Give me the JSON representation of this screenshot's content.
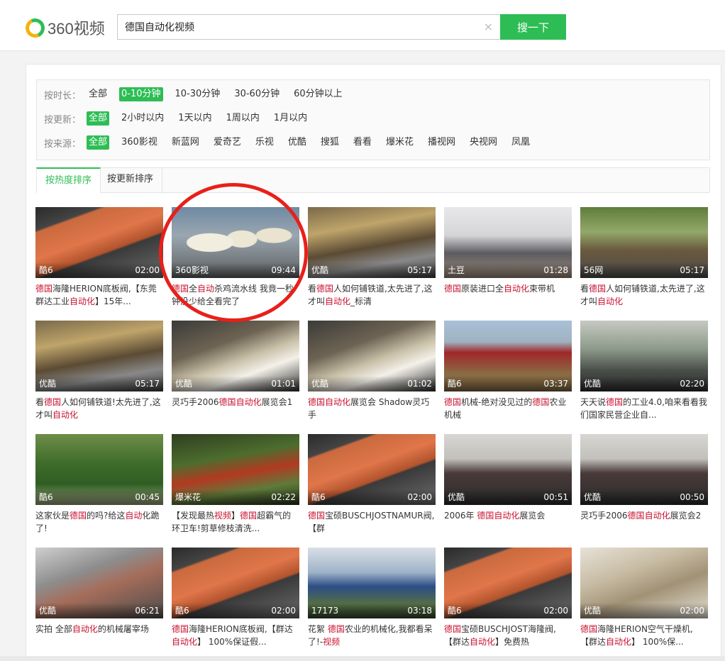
{
  "header": {
    "logo_text": "360视频",
    "search_value": "德国自动化视频",
    "clear_icon": "×",
    "search_button": "搜一下"
  },
  "filters": {
    "time": {
      "label": "按时长：",
      "options": [
        "全部",
        "0-10分钟",
        "10-30分钟",
        "30-60分钟",
        "60分钟以上"
      ],
      "active": 1
    },
    "update": {
      "label": "按更新：",
      "options": [
        "全部",
        "2小时以内",
        "1天以内",
        "1周以内",
        "1月以内"
      ],
      "active": 0
    },
    "source": {
      "label": "按来源：",
      "options": [
        "全部",
        "360影视",
        "新蓝网",
        "爱奇艺",
        "乐视",
        "优酷",
        "搜狐",
        "看看",
        "爆米花",
        "播视网",
        "央视网",
        "凤凰"
      ],
      "active": 0
    }
  },
  "tabs": [
    "按热度排序",
    "按更新排序"
  ],
  "videos": [
    {
      "source": "酷6",
      "duration": "02:00",
      "title": [
        [
          "德国",
          true
        ],
        [
          "海隆HERION底板阀,【东莞群达工业",
          false
        ],
        [
          "自动化",
          true
        ],
        [
          "】15年...",
          false
        ]
      ],
      "thumb": "t-orange"
    },
    {
      "source": "360影视",
      "duration": "09:44",
      "title": [
        [
          "德国",
          true
        ],
        [
          "全",
          false
        ],
        [
          "自动",
          true
        ],
        [
          "杀鸡流水线 我竟一秒钟没少给全看完了",
          false
        ]
      ],
      "thumb": "t-chicken"
    },
    {
      "source": "优酷",
      "duration": "05:17",
      "title": [
        [
          "看",
          false
        ],
        [
          "德国",
          true
        ],
        [
          "人如何铺铁道,太先进了,这才叫",
          false
        ],
        [
          "自动化",
          true
        ],
        [
          "_标清",
          false
        ]
      ],
      "thumb": "t-rail"
    },
    {
      "source": "土豆",
      "duration": "01:28",
      "title": [
        [
          "德国",
          true
        ],
        [
          "原装进口全",
          false
        ],
        [
          "自动化",
          true
        ],
        [
          "束带机",
          false
        ]
      ],
      "thumb": "t-machine"
    },
    {
      "source": "56网",
      "duration": "05:17",
      "title": [
        [
          "看",
          false
        ],
        [
          "德国",
          true
        ],
        [
          "人如何铺铁道,太先进了,这才叫",
          false
        ],
        [
          "自动化",
          true
        ]
      ],
      "thumb": "t-field"
    },
    {
      "source": "优酷",
      "duration": "05:17",
      "title": [
        [
          "看",
          false
        ],
        [
          "德国",
          true
        ],
        [
          "人如何铺铁道!太先进了,这才叫",
          false
        ],
        [
          "自动化",
          true
        ]
      ],
      "thumb": "t-rail"
    },
    {
      "source": "优酷",
      "duration": "01:01",
      "title": [
        [
          "灵巧手2006",
          false
        ],
        [
          "德国",
          true
        ],
        [
          "自动化",
          true
        ],
        [
          "展览会1",
          false
        ]
      ],
      "thumb": "t-robot"
    },
    {
      "source": "优酷",
      "duration": "01:02",
      "title": [
        [
          "德国",
          true
        ],
        [
          "自动化",
          true
        ],
        [
          "展览会 Shadow灵巧手",
          false
        ]
      ],
      "thumb": "t-robot"
    },
    {
      "source": "酷6",
      "duration": "03:37",
      "title": [
        [
          "德国",
          true
        ],
        [
          "机械-绝对没见过的",
          false
        ],
        [
          "德国",
          true
        ],
        [
          "农业机械",
          false
        ]
      ],
      "thumb": "t-tractor"
    },
    {
      "source": "优酷",
      "duration": "02:20",
      "title": [
        [
          "天天说",
          false
        ],
        [
          "德国",
          true
        ],
        [
          "的工业4.0,咱来看看我们国家民营企业自...",
          false
        ]
      ],
      "thumb": "t-factory"
    },
    {
      "source": "酷6",
      "duration": "00:45",
      "title": [
        [
          "这家伙是",
          false
        ],
        [
          "德国",
          true
        ],
        [
          "的吗?给这",
          false
        ],
        [
          "自动",
          true
        ],
        [
          "化",
          false
        ],
        [
          "跪了!",
          false
        ]
      ],
      "thumb": "t-hedge"
    },
    {
      "source": "爆米花",
      "duration": "02:22",
      "title": [
        [
          "【发现最热",
          false
        ],
        [
          "视频",
          true
        ],
        [
          "】",
          false
        ],
        [
          "德国",
          true
        ],
        [
          "超霸气的环卫车!剪草修枝清洗...",
          false
        ]
      ],
      "thumb": "t-garden"
    },
    {
      "source": "酷6",
      "duration": "02:00",
      "title": [
        [
          "德国",
          true
        ],
        [
          "宝硕BUSCHJOSTNAMUR阀,【群",
          false
        ]
      ],
      "thumb": "t-orange"
    },
    {
      "source": "优酷",
      "duration": "00:51",
      "title": [
        [
          "2006年 ",
          false
        ],
        [
          "德国",
          true
        ],
        [
          "自动化",
          true
        ],
        [
          "展览会",
          false
        ]
      ],
      "thumb": "t-expo"
    },
    {
      "source": "优酷",
      "duration": "00:50",
      "title": [
        [
          "灵巧手2006",
          false
        ],
        [
          "德国",
          true
        ],
        [
          "自动化",
          true
        ],
        [
          "展览会2",
          false
        ]
      ],
      "thumb": "t-expo"
    },
    {
      "source": "优酷",
      "duration": "06:21",
      "title": [
        [
          "实拍 全部",
          false
        ],
        [
          "自动化",
          true
        ],
        [
          "的机械屠宰场",
          false
        ]
      ],
      "thumb": "t-slaughter"
    },
    {
      "source": "酷6",
      "duration": "02:00",
      "title": [
        [
          "德国",
          true
        ],
        [
          "海隆HERION底板阀,【群达",
          false
        ],
        [
          "自动化",
          true
        ],
        [
          "】 100%保证假...",
          false
        ]
      ],
      "thumb": "t-orange"
    },
    {
      "source": "17173",
      "duration": "03:18",
      "title": [
        [
          "花絮 ",
          false
        ],
        [
          "德国",
          true
        ],
        [
          "农业的机械化,我都看呆了!-",
          false
        ],
        [
          "视频",
          true
        ]
      ],
      "thumb": "t-farmer"
    },
    {
      "source": "酷6",
      "duration": "02:00",
      "title": [
        [
          "德国",
          true
        ],
        [
          "宝硕BUSCHJOST海隆阀,【群达",
          false
        ],
        [
          "自动化",
          true
        ],
        [
          "】免费热",
          false
        ]
      ],
      "thumb": "t-orange"
    },
    {
      "source": "优酷",
      "duration": "02:00",
      "title": [
        [
          "德国",
          true
        ],
        [
          "海隆HERION空气干燥机,【群达",
          false
        ],
        [
          "自动化",
          true
        ],
        [
          "】 100%保...",
          false
        ]
      ],
      "thumb": "t-parts"
    }
  ]
}
